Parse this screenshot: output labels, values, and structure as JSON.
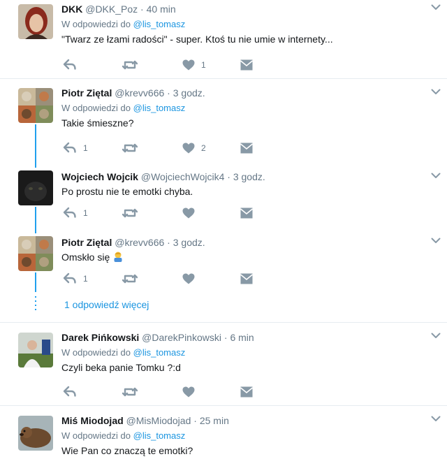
{
  "colors": {
    "link": "#1b95e0",
    "thread": "#20a0ee",
    "muted": "#657786",
    "icon": "#8899a6"
  },
  "icons": {
    "reply": "reply-icon",
    "retweet": "retweet-icon",
    "like": "heart-icon",
    "dm": "envelope-icon",
    "menu": "chevron-down-icon"
  },
  "tweets": [
    {
      "name": "DKK",
      "handle": "@DKK_Poz",
      "time": "40 min",
      "reply_prefix": "W odpowiedzi do",
      "reply_to": "@lis_tomasz",
      "text": "\"Twarz ze łzami radości\" - super. Ktoś tu nie umie w internety...",
      "reply_count": "",
      "retweet_count": "",
      "like_count": "1"
    },
    {
      "name": "Piotr Ziętal",
      "handle": "@krevv666",
      "time": "3 godz.",
      "reply_prefix": "W odpowiedzi do",
      "reply_to": "@lis_tomasz",
      "text": "Takie śmieszne?",
      "reply_count": "1",
      "retweet_count": "",
      "like_count": "2"
    },
    {
      "name": "Wojciech Wojcik",
      "handle": "@WojciechWojcik4",
      "time": "3 godz.",
      "text": "Po prostu nie te emotki chyba.",
      "reply_count": "1",
      "retweet_count": "",
      "like_count": ""
    },
    {
      "name": "Piotr Ziętal",
      "handle": "@krevv666",
      "time": "3 godz.",
      "text": "Omskło się",
      "reply_count": "1",
      "retweet_count": "",
      "like_count": ""
    },
    {
      "name": "Darek Pińkowski",
      "handle": "@DarekPinkowski",
      "time": "6 min",
      "reply_prefix": "W odpowiedzi do",
      "reply_to": "@lis_tomasz",
      "text": "Czyli beka panie Tomku ?:d",
      "reply_count": "",
      "retweet_count": "",
      "like_count": ""
    },
    {
      "name": "Miś Miodojad",
      "handle": "@MisMiodojad",
      "time": "25 min",
      "reply_prefix": "W odpowiedzi do",
      "reply_to": "@lis_tomasz",
      "text": "Wie Pan co znaczą te emotki?"
    }
  ],
  "thread": {
    "more_replies": "1 odpowiedź więcej"
  },
  "separator": "·"
}
